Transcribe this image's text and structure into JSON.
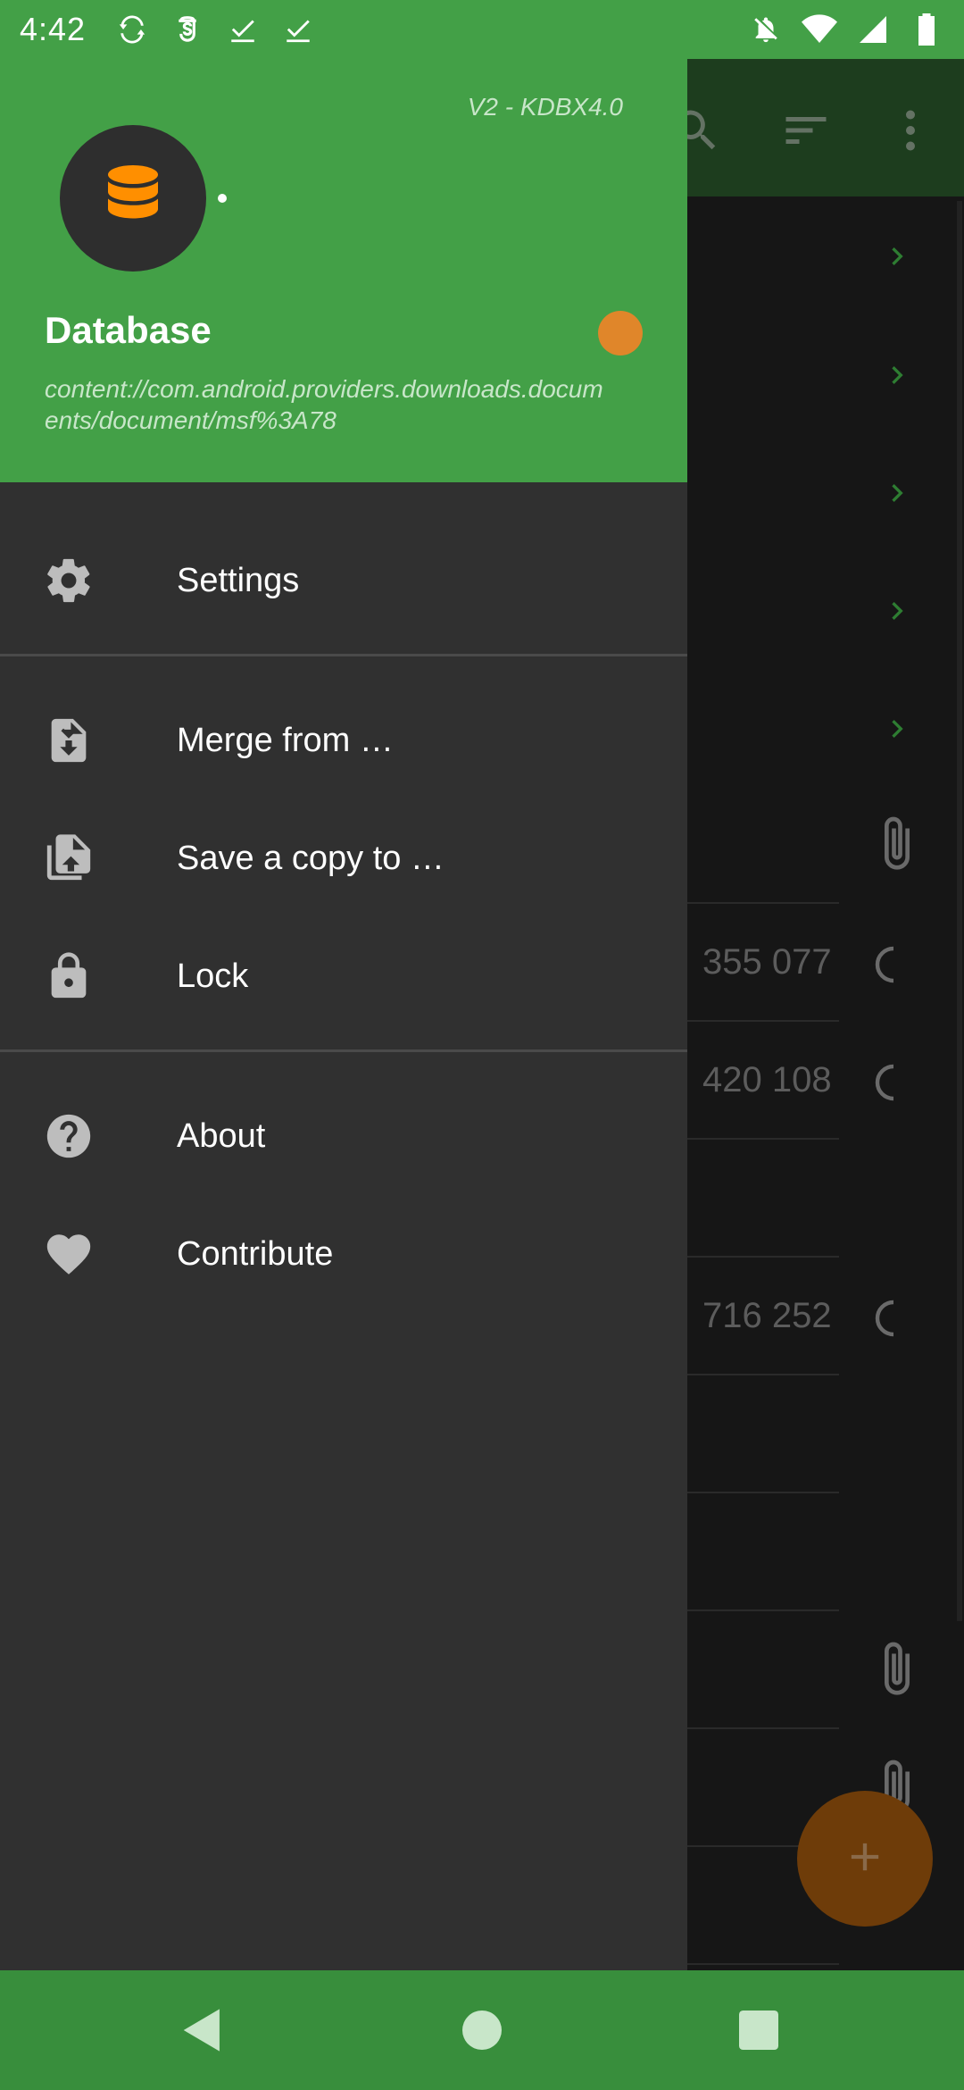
{
  "status_bar": {
    "time": "4:42",
    "left_icons": [
      "sync-icon",
      "shield-s-icon",
      "checkmark-icon",
      "checkmark-icon"
    ],
    "right_icons": [
      "notifications-off-icon",
      "wifi-icon",
      "signal-icon",
      "battery-icon"
    ]
  },
  "drawer": {
    "header": {
      "version": "V2 - KDBX4.0",
      "database_name": "Database",
      "database_path": "content://com.android.providers.downloads.documents/document/msf%3A78",
      "status_color": "#e0862a",
      "background_color": "#43a047"
    },
    "sections": [
      {
        "items": [
          {
            "label": "Settings",
            "icon": "gear-icon"
          }
        ]
      },
      {
        "items": [
          {
            "label": "Merge from …",
            "icon": "merge-file-icon"
          },
          {
            "label": "Save a copy to …",
            "icon": "save-copy-icon"
          },
          {
            "label": "Lock",
            "icon": "lock-icon"
          }
        ]
      },
      {
        "items": [
          {
            "label": "About",
            "icon": "help-icon"
          },
          {
            "label": "Contribute",
            "icon": "heart-icon"
          }
        ]
      }
    ]
  },
  "background_list": {
    "visible_numbers": [
      "355 077",
      "420 108",
      "716 252"
    ]
  },
  "fab": {
    "icon": "plus-icon",
    "color": "#e65100"
  },
  "nav_bar": {
    "buttons": [
      "back-icon",
      "home-icon",
      "recents-icon"
    ]
  }
}
